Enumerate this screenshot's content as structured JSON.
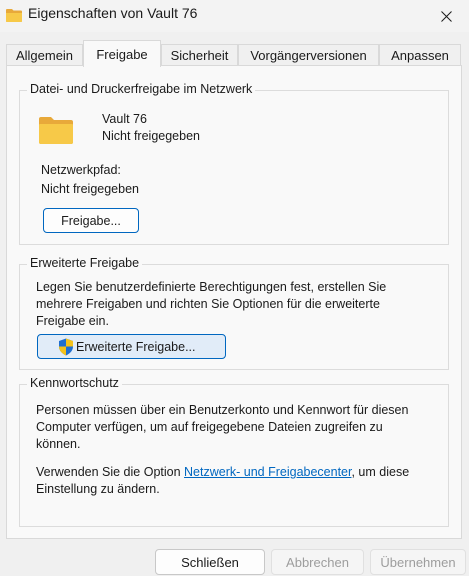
{
  "window": {
    "title": "Eigenschaften von Vault 76",
    "close_icon": "close-icon",
    "folder_icon": "folder-icon"
  },
  "tabs": [
    {
      "label": "Allgemein"
    },
    {
      "label": "Freigabe"
    },
    {
      "label": "Sicherheit"
    },
    {
      "label": "Vorgängerversionen"
    },
    {
      "label": "Anpassen"
    }
  ],
  "active_tab": "Freigabe",
  "network_sharing": {
    "group_title": "Datei- und Druckerfreigabe im Netzwerk",
    "folder_name": "Vault 76",
    "folder_status": "Nicht freigegeben",
    "path_label": "Netzwerkpfad:",
    "path_value": "Nicht freigegeben",
    "share_button": "Freigabe..."
  },
  "advanced_sharing": {
    "group_title": "Erweiterte Freigabe",
    "description_line1": "Legen Sie benutzerdefinierte Berechtigungen fest, erstellen Sie",
    "description_line2": "mehrere Freigaben und richten Sie Optionen für die erweiterte",
    "description_line3": "Freigabe ein.",
    "button": "Erweiterte Freigabe...",
    "shield_icon": "uac-shield-icon"
  },
  "password_protection": {
    "group_title": "Kennwortschutz",
    "line1": "Personen müssen über ein Benutzerkonto und Kennwort für diesen",
    "line2": "Computer verfügen, um auf freigegebene Dateien zugreifen zu",
    "line3": "können.",
    "option_prefix": "Verwenden Sie die Option ",
    "option_link": "Netzwerk- und Freigabecenter",
    "option_suffix": ", um diese",
    "option_line2": "Einstellung zu ändern."
  },
  "footer": {
    "close_button": "Schließen",
    "cancel_button": "Abbrechen",
    "apply_button": "Übernehmen"
  },
  "colors": {
    "accent": "#0067c0",
    "folder": "#f5c242"
  }
}
